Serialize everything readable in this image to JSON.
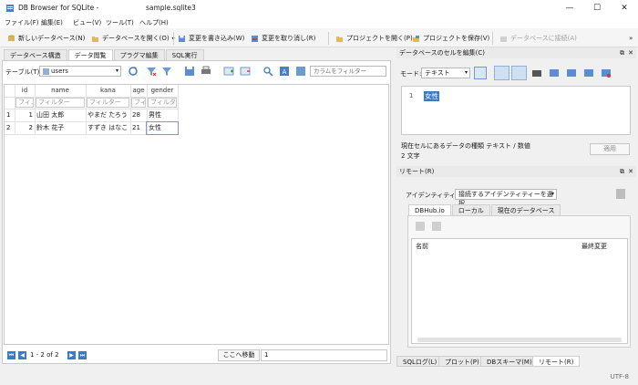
{
  "window": {
    "app_title": "DB Browser for SQLite -",
    "file_name": "sample.sqlite3"
  },
  "menu": [
    "ファイル(F)",
    "編集(E)",
    "ビュー(V)",
    "ツール(T)",
    "ヘルプ(H)"
  ],
  "toolbar": {
    "new_db": "新しいデータベース(N)",
    "open_db": "データベースを開く(O)",
    "write_changes": "変更を書き込み(W)",
    "revert_changes": "変更を取り消し(R)",
    "open_project": "プロジェクトを開く(P)",
    "save_project": "プロジェクトを保存(V)",
    "attach_db": "データベースに接続(A)"
  },
  "main_tabs": [
    "データベース構造",
    "データ閲覧",
    "プラグマ編集",
    "SQL実行"
  ],
  "browse": {
    "table_label": "テーブル(T):",
    "table_selected": "users",
    "filter_placeholder": "カラムをフィルター",
    "columns": [
      "id",
      "name",
      "kana",
      "age",
      "gender"
    ],
    "filter_cells": [
      "フィ…",
      "フィルター",
      "フィルター",
      "フィ…",
      "フィルター"
    ],
    "rows": [
      {
        "row_no": "1",
        "cells": [
          "1",
          "山田 太郎",
          "やまだ たろう",
          "28",
          "男性"
        ]
      },
      {
        "row_no": "2",
        "cells": [
          "2",
          "鈴木 花子",
          "すずき はなこ",
          "21",
          "女性"
        ]
      }
    ],
    "page_info": "1 - 2 of 2",
    "goto_label": "ここへ移動",
    "goto_value": "1"
  },
  "edit_cell": {
    "title": "データベースのセルを編集(C)",
    "mode_label": "モード:",
    "mode_value": "テキスト",
    "line_no": "1",
    "cell_text": "女性",
    "type_info": "現在セルにあるデータの種類 テキスト / 数値",
    "size_info": "2 文字",
    "apply_label": "適用"
  },
  "remote": {
    "title": "リモート(R)",
    "identity_label": "アイデンティティー",
    "identity_value": "接続するアイデンティティーを選択",
    "tabs": [
      "DBHub.io",
      "ローカル",
      "現在のデータベース"
    ],
    "col_name": "名前",
    "col_last_modified": "最終変更"
  },
  "bottom_tabs": [
    "SQLログ(L)",
    "プロット(P)",
    "DBスキーマ(M)",
    "リモート(R)"
  ],
  "status": {
    "encoding": "UTF-8"
  }
}
